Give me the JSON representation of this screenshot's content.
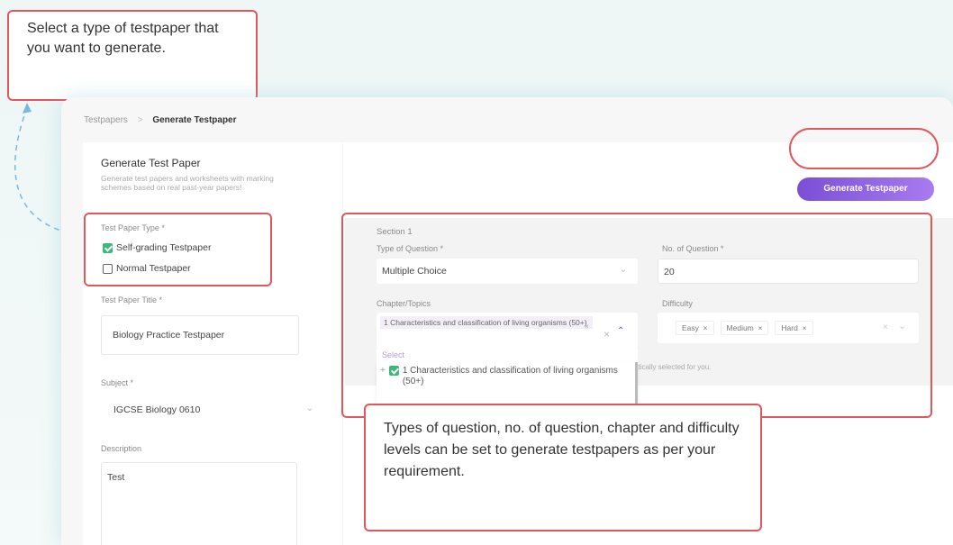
{
  "callouts": {
    "top": "Select a type of testpaper that you want to generate.",
    "bottom": "Types of question, no. of question, chapter and difficulty levels can be set to generate testpapers as per your requirement."
  },
  "breadcrumb": {
    "parent": "Testpapers",
    "separator": ">",
    "current": "Generate Testpaper"
  },
  "left": {
    "title": "Generate Test Paper",
    "description": "Generate test papers and worksheets with marking schemes based on real past-year papers!",
    "type_label": "Test Paper Type *",
    "option_self": "Self-grading Testpaper",
    "option_normal": "Normal Testpaper",
    "title_label": "Test Paper Title *",
    "title_value": "Biology Practice Testpaper",
    "subject_label": "Subject *",
    "subject_value": "IGCSE Biology 0610",
    "description_label": "Description",
    "description_value": "Test"
  },
  "right": {
    "generate_button": "Generate Testpaper",
    "section_title": "Section 1",
    "type_q_label": "Type of Question *",
    "type_q_value": "Multiple Choice",
    "num_q_label": "No. of Question *",
    "num_q_value": "20",
    "chapter_label": "Chapter/Topics",
    "chapter_tag": "1 Characteristics and classification of living organisms (50+)",
    "select_placeholder": "Select",
    "dropdown_item": "1 Characteristics and classification of living organisms (50+)",
    "difficulty_label": "Difficulty",
    "difficulty_tags": [
      "Easy",
      "Medium",
      "Hard"
    ],
    "hint_fragment": "atically selected for you."
  }
}
